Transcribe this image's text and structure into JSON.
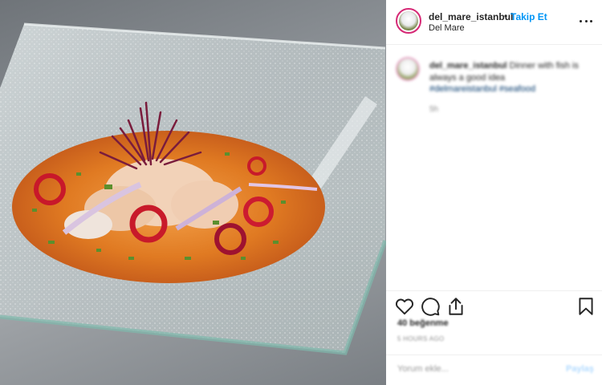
{
  "post": {
    "image_alt": "Del Mare dish photo",
    "colors": {
      "accent": "#0095f6",
      "text": "#262626",
      "muted": "#8e8e8e",
      "hashtag": "#00376b"
    }
  },
  "header": {
    "username": "del_mare_istanbul",
    "separator": "•",
    "follow_label": "Takip Et",
    "location": "Del Mare",
    "more_icon": "more-horizontal-icon"
  },
  "caption": {
    "username": "del_mare_istanbul",
    "text": "Dinner with fish is always a good idea",
    "hashtags": "#delmareistanbul #seafood",
    "time": "5h"
  },
  "actions": {
    "icons": [
      "heart-icon",
      "comment-icon",
      "share-icon",
      "bookmark-icon"
    ],
    "likes": "40 beğenme",
    "date": "5 hours ago"
  },
  "comment": {
    "placeholder": "Yorum ekle...",
    "post_label": "Paylaş"
  }
}
